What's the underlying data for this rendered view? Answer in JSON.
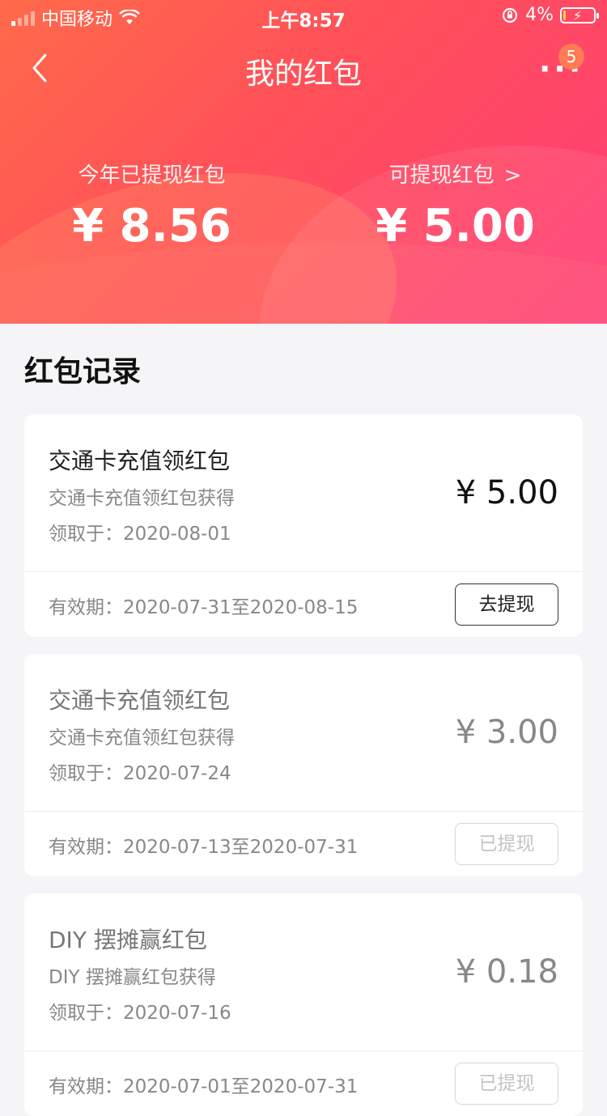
{
  "status_bar": {
    "carrier": "中国移动",
    "time": "上午8:57",
    "battery_percent": "4%",
    "battery_level": 0.04
  },
  "nav": {
    "title": "我的红包",
    "more_badge": "5"
  },
  "summary": {
    "withdrawn_label": "今年已提现红包",
    "withdrawn_amount": "¥ 8.56",
    "available_label": "可提现红包",
    "available_amount": "¥ 5.00"
  },
  "records": {
    "title": "红包记录",
    "items": [
      {
        "name": "交通卡充值领红包",
        "desc": "交通卡充值领红包获得",
        "date": "领取于：2020-08-01",
        "amount": "¥ 5.00",
        "validity": "有效期：2020-07-31至2020-08-15",
        "action": "去提现"
      },
      {
        "name": "交通卡充值领红包",
        "desc": "交通卡充值领红包获得",
        "date": "领取于：2020-07-24",
        "amount": "¥ 3.00",
        "validity": "有效期：2020-07-13至2020-07-31",
        "action": "已提现"
      },
      {
        "name": "DIY 摆摊赢红包",
        "desc": "DIY 摆摊赢红包获得",
        "date": "领取于：2020-07-16",
        "amount": "¥ 0.18",
        "validity": "有效期：2020-07-01至2020-07-31",
        "action": "已提现"
      }
    ]
  },
  "colors": {
    "hero_start": "#ff6a4a",
    "hero_end": "#ff3d78",
    "badge": "#ff7a55"
  }
}
